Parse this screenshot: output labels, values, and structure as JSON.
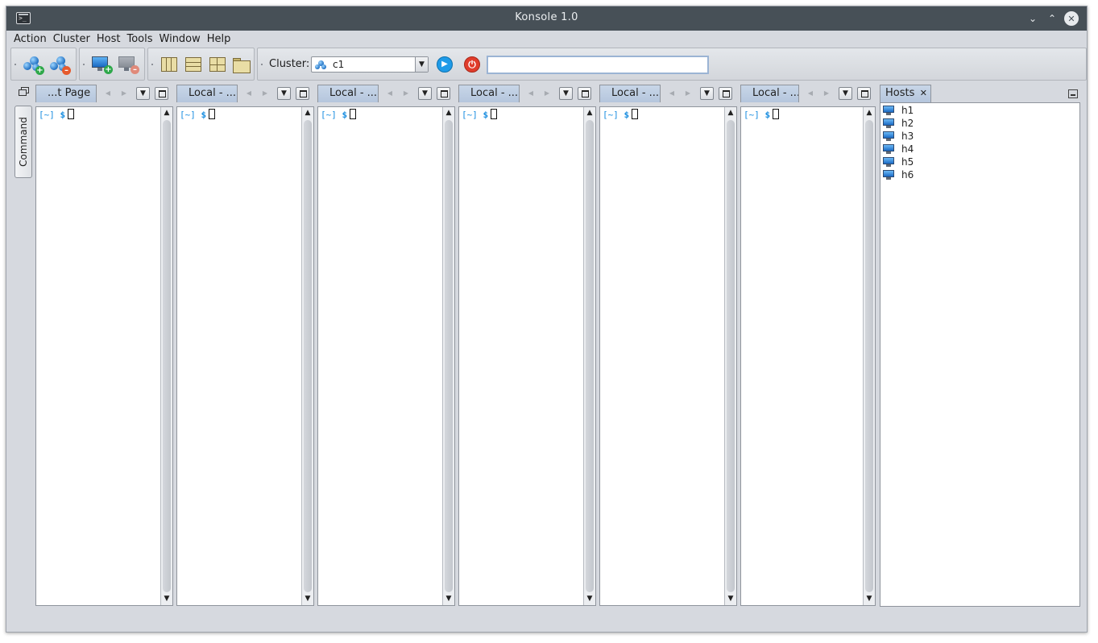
{
  "window": {
    "title": "Konsole 1.0"
  },
  "menu": [
    "Action",
    "Cluster",
    "Host",
    "Tools",
    "Window",
    "Help"
  ],
  "toolbar": {
    "cluster_label": "Cluster:",
    "cluster_selected": "c1",
    "command_value": ""
  },
  "side": {
    "command_tab": "Command"
  },
  "terminals": [
    {
      "tab": "...t Page",
      "prompt": "[~]",
      "symbol": "$"
    },
    {
      "tab": "Local - ...",
      "prompt": "[~]",
      "symbol": "$"
    },
    {
      "tab": "Local - ...",
      "prompt": "[~]",
      "symbol": "$"
    },
    {
      "tab": "Local - ...",
      "prompt": "[~]",
      "symbol": "$"
    },
    {
      "tab": "Local - ...",
      "prompt": "[~]",
      "symbol": "$"
    },
    {
      "tab": "Local - ...",
      "prompt": "[~]",
      "symbol": "$"
    }
  ],
  "hosts": {
    "tab": "Hosts",
    "items": [
      "h1",
      "h2",
      "h3",
      "h4",
      "h5",
      "h6"
    ]
  },
  "colors": {
    "accent": "#1a8ee0",
    "titlebar": "#475057",
    "window_bg": "#d6d9df",
    "run": "#1e9be8",
    "stop": "#e03c2b"
  }
}
